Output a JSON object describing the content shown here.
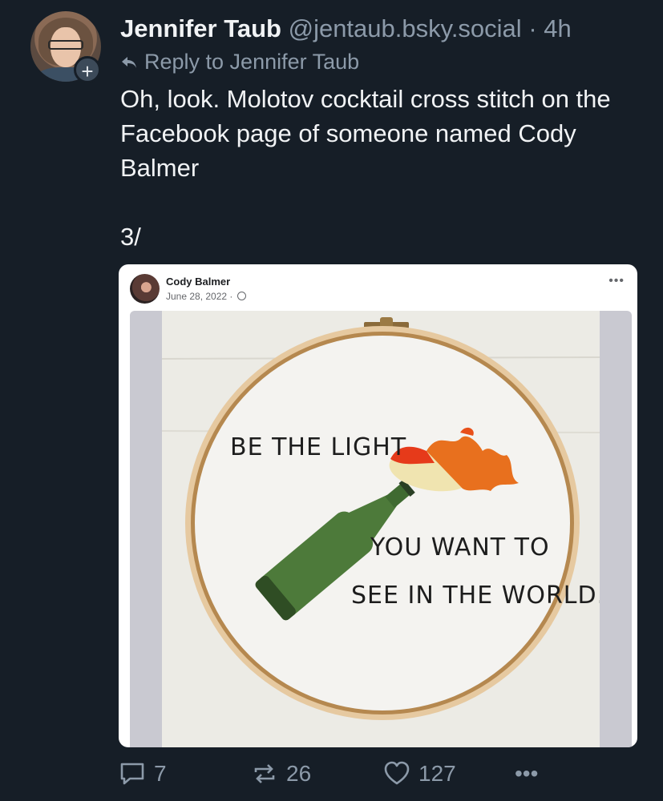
{
  "post": {
    "author": {
      "display_name": "Jennifer Taub",
      "handle": "@jentaub.bsky.social",
      "separator": "·",
      "time": "4h",
      "avatar_icon": "avatar-photo",
      "follow_badge": "+"
    },
    "reply_to": "Reply to Jennifer Taub",
    "text": "Oh, look. Molotov cocktail cross stitch on the Facebook page of someone named Cody Balmer\n\n3/",
    "embed": {
      "name": "Cody Balmer",
      "date": "June 28, 2022 ·",
      "more_label": "•••",
      "image_text": {
        "line1": "BE THE LIGHT",
        "line2": "YOU WANT TO",
        "line3": "SEE IN THE WORLD."
      }
    },
    "actions": {
      "replies": "7",
      "reposts": "26",
      "likes": "127",
      "more": "•••"
    }
  },
  "colors": {
    "background": "#161e27",
    "muted": "#8c9aa9",
    "text": "#f1f3f5"
  }
}
